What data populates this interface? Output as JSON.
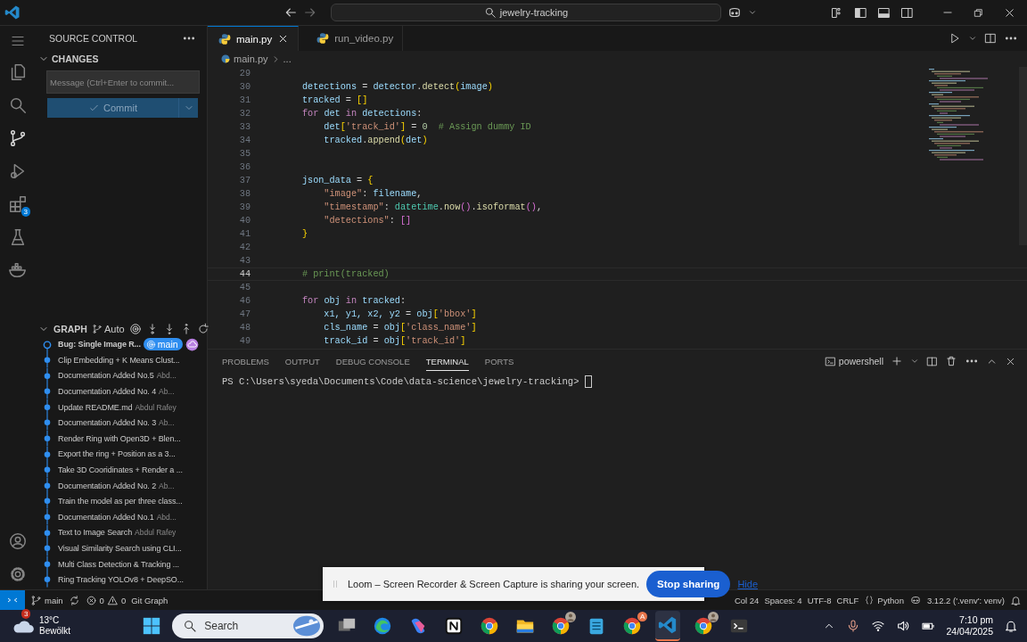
{
  "title_bar": {
    "search": "jewelry-tracking"
  },
  "activity_bar": {
    "items": [
      {
        "kind": "files",
        "selected": false
      },
      {
        "kind": "search",
        "selected": false
      },
      {
        "kind": "source-control",
        "selected": true
      },
      {
        "kind": "run",
        "selected": false
      },
      {
        "kind": "extensions",
        "selected": false,
        "badge": "3"
      },
      {
        "kind": "testing",
        "selected": false
      },
      {
        "kind": "docker",
        "selected": false
      }
    ],
    "bottom": [
      {
        "kind": "account"
      },
      {
        "kind": "settings"
      }
    ]
  },
  "sidebar": {
    "title": "SOURCE CONTROL",
    "changes": {
      "title": "CHANGES",
      "expanded": true,
      "placeholder": "Message (Ctrl+Enter to commit...",
      "commit": {
        "label": "Commit",
        "disabled": true
      }
    },
    "graph": {
      "title": "GRAPH",
      "expanded": true,
      "mode": "Auto",
      "commits": [
        {
          "message": "Bug: Single Image R...",
          "head": true,
          "branch": "main"
        },
        {
          "message": "Clip Embedding + K Means Clust...",
          "head": false
        },
        {
          "message": "Documentation Added No.5",
          "author": "Abd...",
          "head": false
        },
        {
          "message": "Documentation Added No. 4",
          "author": "Ab...",
          "head": false
        },
        {
          "message": "Update README.md",
          "author": "Abdul Rafey",
          "head": false
        },
        {
          "message": "Documentation Added No. 3",
          "author": "Ab...",
          "head": false
        },
        {
          "message": "Render Ring with Open3D + Blen...",
          "head": false
        },
        {
          "message": "Export the ring + Position as a 3...",
          "head": false
        },
        {
          "message": "Take 3D Cooridinates + Render a ...",
          "head": false
        },
        {
          "message": "Documentation Added No. 2",
          "author": "Ab...",
          "head": false
        },
        {
          "message": "Train the model as per three class...",
          "head": false
        },
        {
          "message": "Documentation Added No.1",
          "author": "Abd...",
          "head": false
        },
        {
          "message": "Text to Image Search",
          "author": "Abdul Rafey",
          "head": false
        },
        {
          "message": "Visual Similarity Search using CLI...",
          "head": false
        },
        {
          "message": "Multi Class Detection & Tracking ...",
          "head": false
        },
        {
          "message": "Ring Tracking YOLOv8 + DeepSO...",
          "head": false
        }
      ]
    }
  },
  "editor": {
    "tabs": [
      {
        "label": "main.py",
        "selected": true
      },
      {
        "label": "run_video.py",
        "selected": false
      }
    ],
    "breadcrumb": [
      "main.py",
      "..."
    ],
    "lines": [
      {
        "number": "29",
        "current": false
      },
      {
        "number": "30",
        "current": false,
        "tokens": [
          {
            "kind": "var",
            "text": "        detections"
          },
          {
            "kind": "op",
            "text": " = "
          },
          {
            "kind": "var",
            "text": "detector"
          },
          {
            "kind": "op",
            "text": "."
          },
          {
            "kind": "fn",
            "text": "detect"
          },
          {
            "kind": "b1",
            "text": "("
          },
          {
            "kind": "var",
            "text": "image"
          },
          {
            "kind": "b1",
            "text": ")"
          }
        ]
      },
      {
        "number": "31",
        "current": false,
        "tokens": [
          {
            "kind": "var",
            "text": "        tracked"
          },
          {
            "kind": "op",
            "text": " = "
          },
          {
            "kind": "b1",
            "text": "[]"
          }
        ]
      },
      {
        "number": "32",
        "current": false,
        "tokens": [
          {
            "kind": "kw",
            "text": "        for "
          },
          {
            "kind": "var",
            "text": "det "
          },
          {
            "kind": "kw",
            "text": "in "
          },
          {
            "kind": "var",
            "text": "detections"
          },
          {
            "kind": "op",
            "text": ":"
          }
        ]
      },
      {
        "number": "33",
        "current": false,
        "tokens": [
          {
            "kind": "var",
            "text": "            det"
          },
          {
            "kind": "b1",
            "text": "["
          },
          {
            "kind": "str",
            "text": "'track_id'"
          },
          {
            "kind": "b1",
            "text": "]"
          },
          {
            "kind": "op",
            "text": " = "
          },
          {
            "kind": "num",
            "text": "0"
          },
          {
            "kind": "com",
            "text": "  # Assign dummy ID"
          }
        ]
      },
      {
        "number": "34",
        "current": false,
        "tokens": [
          {
            "kind": "var",
            "text": "            tracked"
          },
          {
            "kind": "op",
            "text": "."
          },
          {
            "kind": "fn",
            "text": "append"
          },
          {
            "kind": "b1",
            "text": "("
          },
          {
            "kind": "var",
            "text": "det"
          },
          {
            "kind": "b1",
            "text": ")"
          }
        ]
      },
      {
        "number": "35",
        "current": false
      },
      {
        "number": "36",
        "current": false
      },
      {
        "number": "37",
        "current": false,
        "tokens": [
          {
            "kind": "var",
            "text": "        json_data"
          },
          {
            "kind": "op",
            "text": " = "
          },
          {
            "kind": "b1",
            "text": "{"
          }
        ]
      },
      {
        "number": "38",
        "current": false,
        "tokens": [
          {
            "kind": "str",
            "text": "            \"image\""
          },
          {
            "kind": "op",
            "text": ": "
          },
          {
            "kind": "var",
            "text": "filename"
          },
          {
            "kind": "op",
            "text": ","
          }
        ]
      },
      {
        "number": "39",
        "current": false,
        "tokens": [
          {
            "kind": "str",
            "text": "            \"timestamp\""
          },
          {
            "kind": "op",
            "text": ": "
          },
          {
            "kind": "cls",
            "text": "datetime"
          },
          {
            "kind": "op",
            "text": "."
          },
          {
            "kind": "fn",
            "text": "now"
          },
          {
            "kind": "b2",
            "text": "()"
          },
          {
            "kind": "op",
            "text": "."
          },
          {
            "kind": "fn",
            "text": "isoformat"
          },
          {
            "kind": "b2",
            "text": "()"
          },
          {
            "kind": "op",
            "text": ","
          }
        ]
      },
      {
        "number": "40",
        "current": false,
        "tokens": [
          {
            "kind": "str",
            "text": "            \"detections\""
          },
          {
            "kind": "op",
            "text": ": "
          },
          {
            "kind": "b2",
            "text": "[]"
          }
        ]
      },
      {
        "number": "41",
        "current": false,
        "tokens": [
          {
            "kind": "b1",
            "text": "        }"
          }
        ]
      },
      {
        "number": "42",
        "current": false
      },
      {
        "number": "43",
        "current": false
      },
      {
        "number": "44",
        "current": true,
        "tokens": [
          {
            "kind": "com",
            "text": "        # print(tracked)"
          }
        ]
      },
      {
        "number": "45",
        "current": false
      },
      {
        "number": "46",
        "current": false,
        "tokens": [
          {
            "kind": "kw",
            "text": "        for "
          },
          {
            "kind": "var",
            "text": "obj "
          },
          {
            "kind": "kw",
            "text": "in "
          },
          {
            "kind": "var",
            "text": "tracked"
          },
          {
            "kind": "op",
            "text": ":"
          }
        ]
      },
      {
        "number": "47",
        "current": false,
        "tokens": [
          {
            "kind": "var",
            "text": "            x1, y1, x2, y2"
          },
          {
            "kind": "op",
            "text": " = "
          },
          {
            "kind": "var",
            "text": "obj"
          },
          {
            "kind": "b1",
            "text": "["
          },
          {
            "kind": "str",
            "text": "'bbox'"
          },
          {
            "kind": "b1",
            "text": "]"
          }
        ]
      },
      {
        "number": "48",
        "current": false,
        "tokens": [
          {
            "kind": "var",
            "text": "            cls_name"
          },
          {
            "kind": "op",
            "text": " = "
          },
          {
            "kind": "var",
            "text": "obj"
          },
          {
            "kind": "b1",
            "text": "["
          },
          {
            "kind": "str",
            "text": "'class_name'"
          },
          {
            "kind": "b1",
            "text": "]"
          }
        ]
      },
      {
        "number": "49",
        "current": false,
        "tokens": [
          {
            "kind": "var",
            "text": "            track_id"
          },
          {
            "kind": "op",
            "text": " = "
          },
          {
            "kind": "var",
            "text": "obj"
          },
          {
            "kind": "b1",
            "text": "["
          },
          {
            "kind": "str",
            "text": "'track_id'"
          },
          {
            "kind": "b1",
            "text": "]"
          }
        ]
      }
    ]
  },
  "panel": {
    "tabs": [
      {
        "label": "PROBLEMS",
        "selected": false
      },
      {
        "label": "OUTPUT",
        "selected": false
      },
      {
        "label": "DEBUG CONSOLE",
        "selected": false
      },
      {
        "label": "TERMINAL",
        "selected": true
      },
      {
        "label": "PORTS",
        "selected": false
      }
    ],
    "shell": "powershell",
    "prompt": "PS C:\\Users\\syeda\\Documents\\Code\\data-science\\jewelry-tracking> "
  },
  "status_bar": {
    "branch": "main",
    "errors": "0",
    "warnings": "0",
    "git_graph": "Git Graph",
    "position": "Col 24",
    "spaces": "Spaces: 4",
    "encoding": "UTF-8",
    "eol": "CRLF",
    "language": "Python",
    "interpreter": "3.12.2 ('.venv': venv)"
  },
  "notification": {
    "message": "Loom – Screen Recorder & Screen Capture is sharing your screen.",
    "button": "Stop sharing",
    "link": "Hide"
  },
  "taskbar": {
    "weather": {
      "temperature": "13°C",
      "condition": "Bewölkt",
      "badge": "3"
    },
    "search": "Search",
    "apps": [
      {
        "kind": "task-view",
        "selected": false
      },
      {
        "kind": "edge",
        "selected": false
      },
      {
        "kind": "copilot",
        "selected": false
      },
      {
        "kind": "notion",
        "selected": false
      },
      {
        "kind": "chrome",
        "selected": false
      },
      {
        "kind": "folder",
        "selected": false
      },
      {
        "kind": "chrome",
        "selected": false,
        "avatar": true
      },
      {
        "kind": "notepad",
        "selected": false
      },
      {
        "kind": "chrome",
        "selected": false,
        "badge": "A"
      },
      {
        "kind": "vscode",
        "selected": true
      },
      {
        "kind": "chrome",
        "selected": false,
        "avatar": true
      },
      {
        "kind": "terminal",
        "selected": false
      }
    ],
    "time": "7:10 pm",
    "date": "24/04/2025"
  }
}
